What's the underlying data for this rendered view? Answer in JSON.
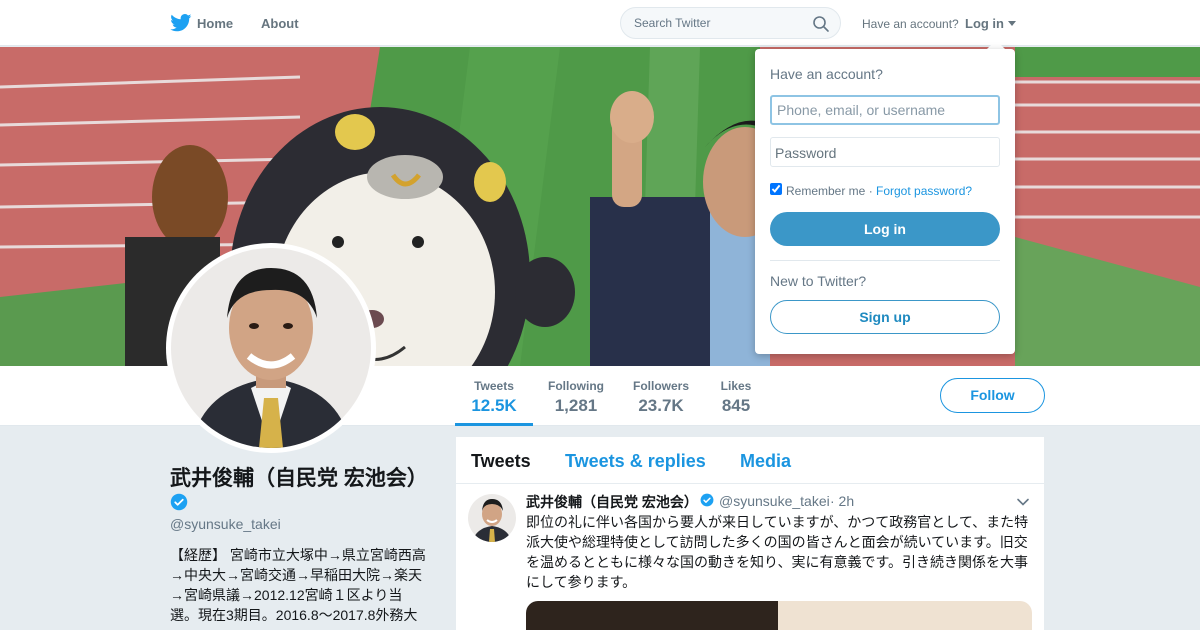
{
  "nav": {
    "logo_icon": "twitter-bird-icon",
    "home_label": "Home",
    "about_label": "About",
    "search_placeholder": "Search Twitter",
    "have_account": "Have an account?",
    "login_label": "Log in"
  },
  "profile_stats": [
    {
      "label": "Tweets",
      "value": "12.5K",
      "active": true
    },
    {
      "label": "Following",
      "value": "1,281",
      "active": false
    },
    {
      "label": "Followers",
      "value": "23.7K",
      "active": false
    },
    {
      "label": "Likes",
      "value": "845",
      "active": false
    }
  ],
  "follow_label": "Follow",
  "profile": {
    "name": "武井俊輔（自民党 宏池会）",
    "handle": "@syunsuke_takei",
    "bio_lines": [
      "【経歴】 宮崎市立大塚中→県立宮崎西高",
      "→中央大→宮崎交通→早稲田大院→楽天",
      "→宮崎県議→2012.12宮崎１区より当",
      "選。現在3期目。2016.8〜2017.8外務大"
    ]
  },
  "tabs": [
    {
      "label": "Tweets",
      "active": true
    },
    {
      "label": "Tweets & replies",
      "active": false
    },
    {
      "label": "Media",
      "active": false
    }
  ],
  "tweet": {
    "name": "武井俊輔（自民党 宏池会）",
    "handle": "@syunsuke_takei",
    "time": "· 2h",
    "text_lines": [
      "即位の礼に伴い各国から要人が来日していますが、かつて政務官として、また特",
      "派大使や総理特使として訪問した多くの国の皆さんと面会が続いています。旧交",
      "を温めるとともに様々な国の動きを知り、実に有意義です。引き続き関係を大事",
      "にして参ります。"
    ]
  },
  "login_dropdown": {
    "title": "Have an account?",
    "username_placeholder": "Phone, email, or username",
    "password_placeholder": "Password",
    "remember_label": "Remember me ·",
    "remember_checked": true,
    "forgot_label": "Forgot password?",
    "login_button": "Log in",
    "new_label": "New to Twitter?",
    "signup_button": "Sign up"
  },
  "colors": {
    "accent": "#1b95e0",
    "login_button": "#3b97c8",
    "verified": "#1da1f2"
  }
}
